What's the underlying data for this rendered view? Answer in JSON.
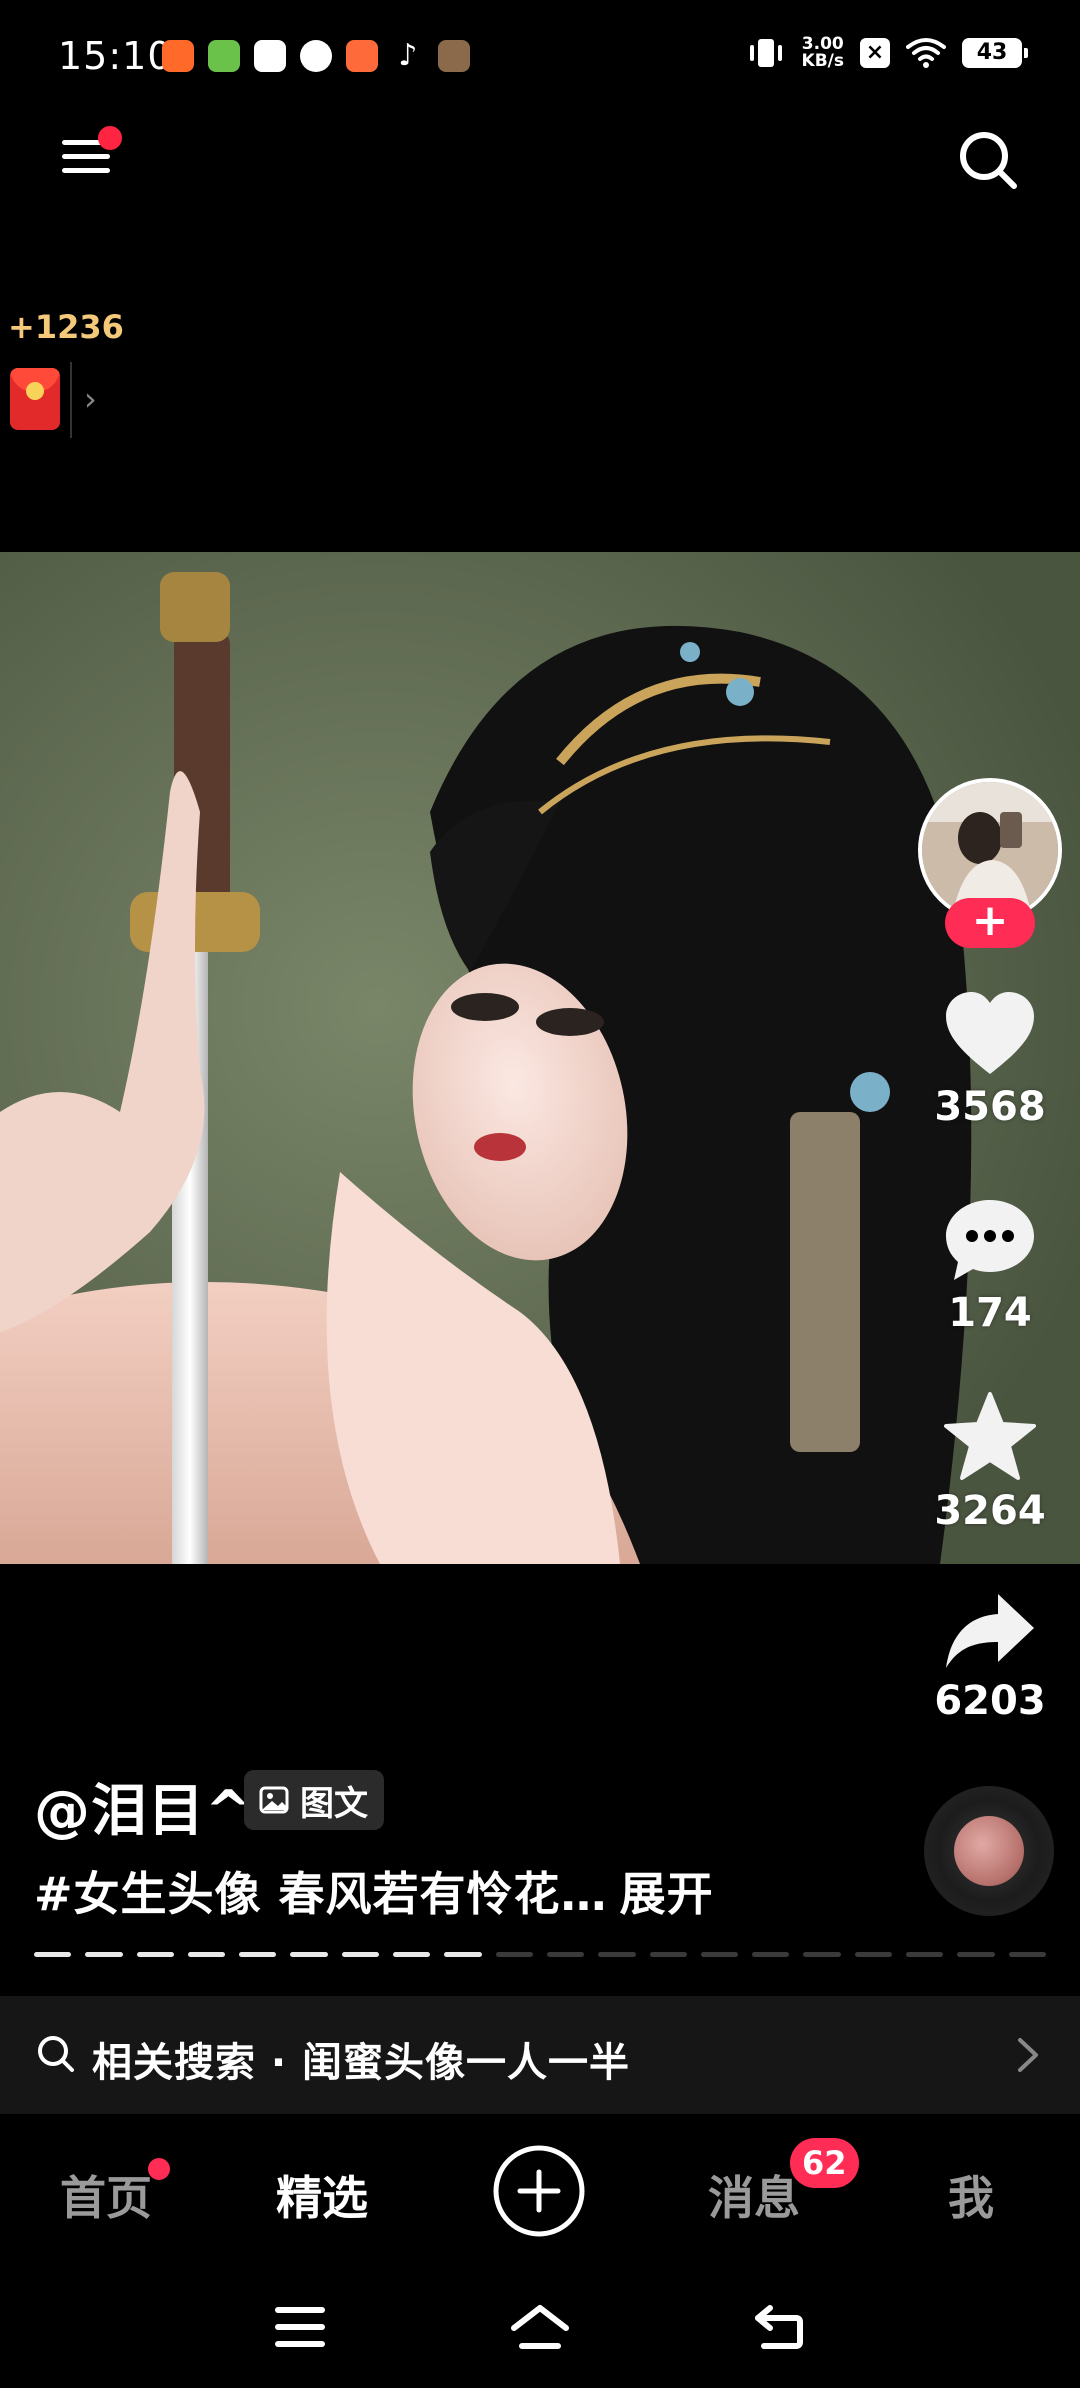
{
  "status_bar": {
    "time": "15:10",
    "net_speed_value": "3.00",
    "net_speed_unit": "KB/s",
    "battery": "43"
  },
  "reward": {
    "count": "+1236"
  },
  "author": {
    "name": "@泪目^"
  },
  "post": {
    "type_label": "图文",
    "caption": "#女生头像 春风若有怜花…",
    "expand_label": "展开",
    "images_total": 20,
    "images_viewed": 9
  },
  "actions": {
    "likes": "3568",
    "comments": "174",
    "favorites": "3264",
    "shares": "6203",
    "follow_symbol": "+"
  },
  "related_search": {
    "text": "相关搜索 · 闺蜜头像一人一半"
  },
  "bottom_nav": {
    "home": "首页",
    "featured": "精选",
    "messages": "消息",
    "messages_badge": "62",
    "me": "我"
  },
  "colors": {
    "accent": "#ff2c55",
    "background": "#000000",
    "reward_gold": "#f5c97a"
  }
}
